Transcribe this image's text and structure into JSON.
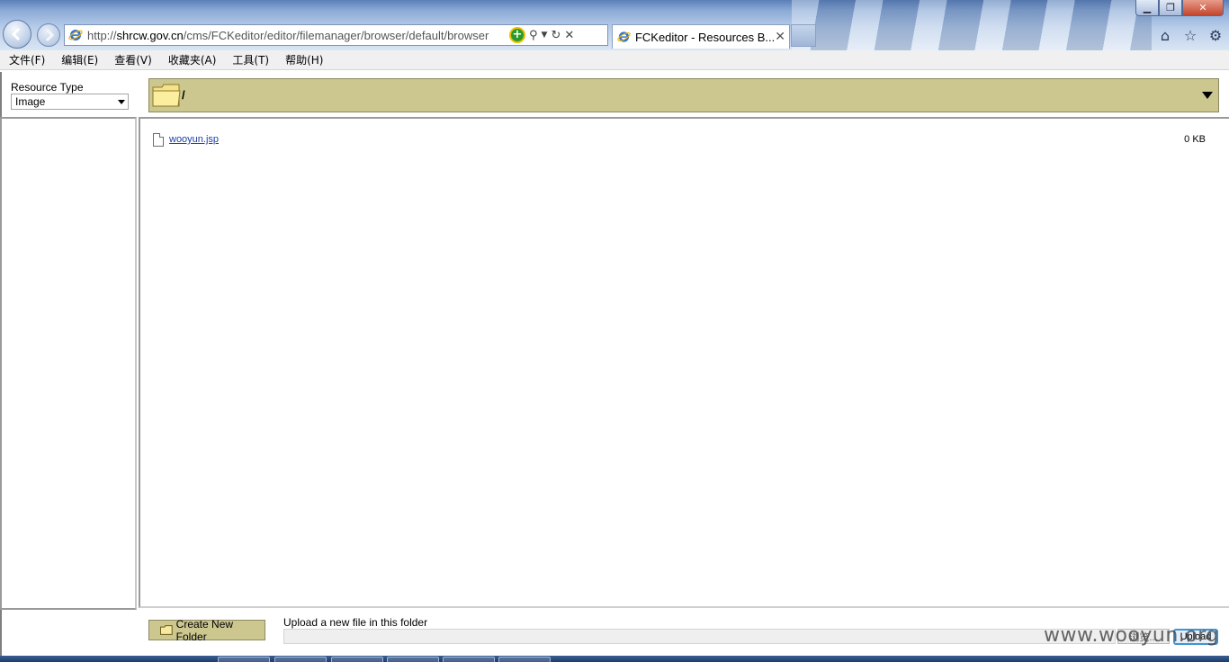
{
  "browser": {
    "url_prefix": "http://",
    "url_host": "shrcw.gov.cn",
    "url_path": "/cms/FCKeditor/editor/filemanager/browser/default/browser",
    "tab_title": "FCKeditor - Resources B...",
    "tab_close": "✕",
    "window_controls": {
      "minimize": "▁",
      "maximize": "❐",
      "close": "✕"
    },
    "icons": [
      "back-icon",
      "forward-icon",
      "ie-icon",
      "compat-view-icon",
      "search-icon",
      "refresh-icon",
      "stop-icon",
      "home-icon",
      "favorites-icon",
      "tools-icon"
    ]
  },
  "menubar": {
    "items": [
      "文件(F)",
      "编辑(E)",
      "查看(V)",
      "收藏夹(A)",
      "工具(T)",
      "帮助(H)"
    ]
  },
  "filemanager": {
    "resource_type_label": "Resource Type",
    "resource_type_value": "Image",
    "current_folder": "/",
    "files": [
      {
        "name": "wooyun.jsp",
        "size": "0 KB"
      }
    ],
    "create_folder_label": "Create New Folder",
    "upload_label": "Upload a new file in this folder",
    "browse_label": "浏览...",
    "upload_button": "Upload"
  },
  "watermark": "www.wooyun.org",
  "colors": {
    "toolbar_bg": "#ccc68f",
    "toolbar_border": "#8d8a60",
    "link": "#1a3fa8",
    "menubar_bg": "#f0f0f0"
  }
}
